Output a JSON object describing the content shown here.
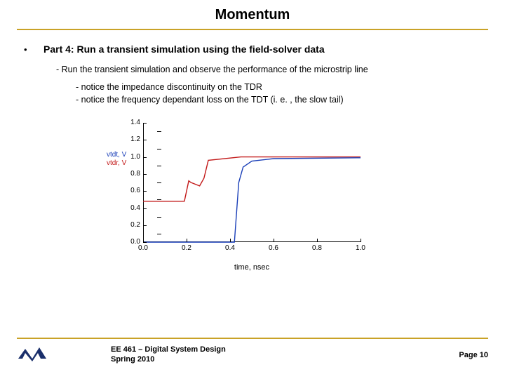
{
  "title": "Momentum",
  "bullet": {
    "marker": "•",
    "heading": "Part 4: Run a transient simulation using the field-solver data"
  },
  "sub1": "- Run the transient simulation and observe the performance of the microstrip line",
  "sub2a": "- notice the impedance discontinuity on the TDR",
  "sub2b": "- notice the frequency dependant loss on the TDT (i. e. , the slow tail)",
  "footer": {
    "course": "EE 461 – Digital System Design",
    "term": "Spring 2010",
    "page": "Page 10"
  },
  "chart_data": {
    "type": "line",
    "xlabel": "time, nsec",
    "ylabel_a": "vtdt, V",
    "ylabel_b": "vtdr, V",
    "xlim": [
      0.0,
      1.0
    ],
    "ylim": [
      0.0,
      1.4
    ],
    "xticks": [
      0.0,
      0.2,
      0.4,
      0.6,
      0.8,
      1.0
    ],
    "yticks": [
      0.0,
      0.2,
      0.4,
      0.6,
      0.8,
      1.0,
      1.2,
      1.4
    ],
    "series": [
      {
        "name": "vtdr",
        "color": "#c21818",
        "x": [
          0.0,
          0.19,
          0.21,
          0.22,
          0.26,
          0.28,
          0.3,
          0.45,
          1.0
        ],
        "y": [
          0.48,
          0.48,
          0.72,
          0.7,
          0.66,
          0.75,
          0.96,
          1.0,
          1.0
        ]
      },
      {
        "name": "vtdt",
        "color": "#1a3fb8",
        "x": [
          0.0,
          0.42,
          0.44,
          0.46,
          0.5,
          0.6,
          1.0
        ],
        "y": [
          0.0,
          0.0,
          0.7,
          0.88,
          0.95,
          0.98,
          0.99
        ]
      }
    ]
  }
}
